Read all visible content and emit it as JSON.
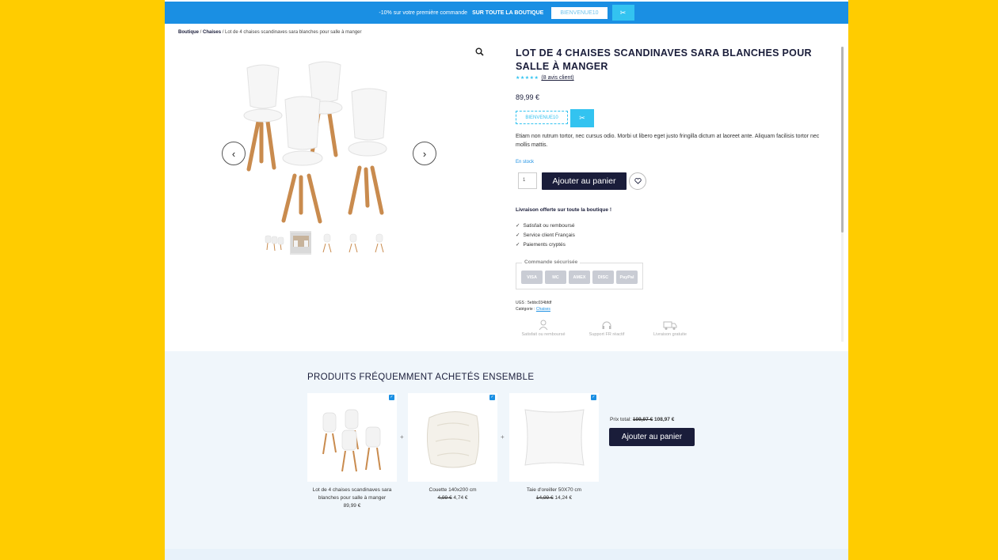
{
  "promo": {
    "text_before": "-10% sur votre première commande",
    "text_bold": "SUR TOUTE LA BOUTIQUE",
    "code": "BIENVENUE10",
    "scissors": "✂"
  },
  "breadcrumb": {
    "home": "Boutique",
    "sep1": " / ",
    "category": "Chaises",
    "sep2": " / ",
    "current": "Lot de 4 chaises scandinaves sara blanches pour salle à manger"
  },
  "gallery": {
    "prev": "‹",
    "next": "›",
    "zoom_icon": "search-icon",
    "thumbnail_count": 5,
    "selected_thumbnail": 2
  },
  "product": {
    "title": "LOT DE 4 CHAISES SCANDINAVES SARA BLANCHES POUR SALLE À MANGER",
    "stars": "★★★★★",
    "reviews": "(8 avis client)",
    "price": "89,99 €",
    "coupon_code": "BIENVENUE10",
    "coupon_icon": "✂",
    "description": "Etiam non rutrum tortor, nec cursus odio. Morbi ut libero eget justo fringilla dictum at laoreet ante. Aliquam facilisis tortor nec mollis mattis.",
    "stock": "En stock",
    "qty": "1",
    "add_to_cart": "Ajouter au panier",
    "shipping": "Livraison offerte sur toute la boutique !",
    "checks": [
      "Satisfait ou remboursé",
      "Service client Français",
      "Paiements cryptés"
    ],
    "secure_legend": "Commande sécurisée",
    "cards": [
      "VISA",
      "MC",
      "AMEX",
      "DISC",
      "PayPal"
    ],
    "sku_label": "UGS :",
    "sku": "5ebbc034bfdf",
    "cat_label": "Catégorie :",
    "cat": "Chaises",
    "features": [
      "Satisfait ou remboursé",
      "Support FR réactif",
      "Livraison gratuite"
    ]
  },
  "fbt": {
    "title": "PRODUITS FRÉQUEMMENT ACHETÉS ENSEMBLE",
    "items": [
      {
        "name": "Lot de 4 chaises scandinaves sara blanches pour salle à manger",
        "old": "",
        "price": "89,99 €"
      },
      {
        "name": "Couette 140x200 cm",
        "old": "4,99 €",
        "price": "4,74 €"
      },
      {
        "name": "Taie d'oreiller 50X70 cm",
        "old": "14,99 €",
        "price": "14,24 €"
      }
    ],
    "total_label": "Prix total:",
    "total_old": "109,97 €",
    "total_new": "108,97 €",
    "button": "Ajouter au panier",
    "plus": "+"
  },
  "colors": {
    "accent": "#33c3f0",
    "promo_bar": "#1a8fe3",
    "dark": "#1a1d3a",
    "background": "#FFCC00"
  }
}
